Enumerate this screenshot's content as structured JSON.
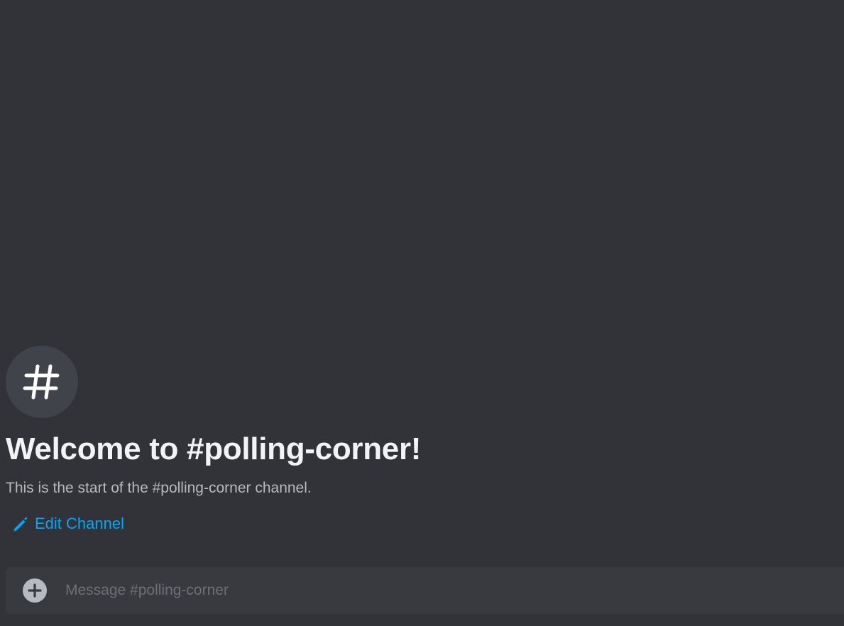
{
  "channel": {
    "name": "#polling-corner",
    "icon": "hashtag-icon"
  },
  "intro": {
    "title": "Welcome to #polling-corner!",
    "subtitle": "This is the start of the #polling-corner channel."
  },
  "actions": {
    "edit_channel_label": "Edit Channel",
    "edit_channel_icon": "pencil-icon"
  },
  "composer": {
    "placeholder": "Message #polling-corner",
    "value": "",
    "attach_icon": "plus-circle-icon"
  },
  "colors": {
    "background": "#313338",
    "composer_background": "#383a40",
    "icon_circle": "#41434a",
    "title_text": "#f2f3f5",
    "subtitle_text": "#b5bac1",
    "link": "#00a8fc",
    "placeholder": "#6d6f78"
  }
}
